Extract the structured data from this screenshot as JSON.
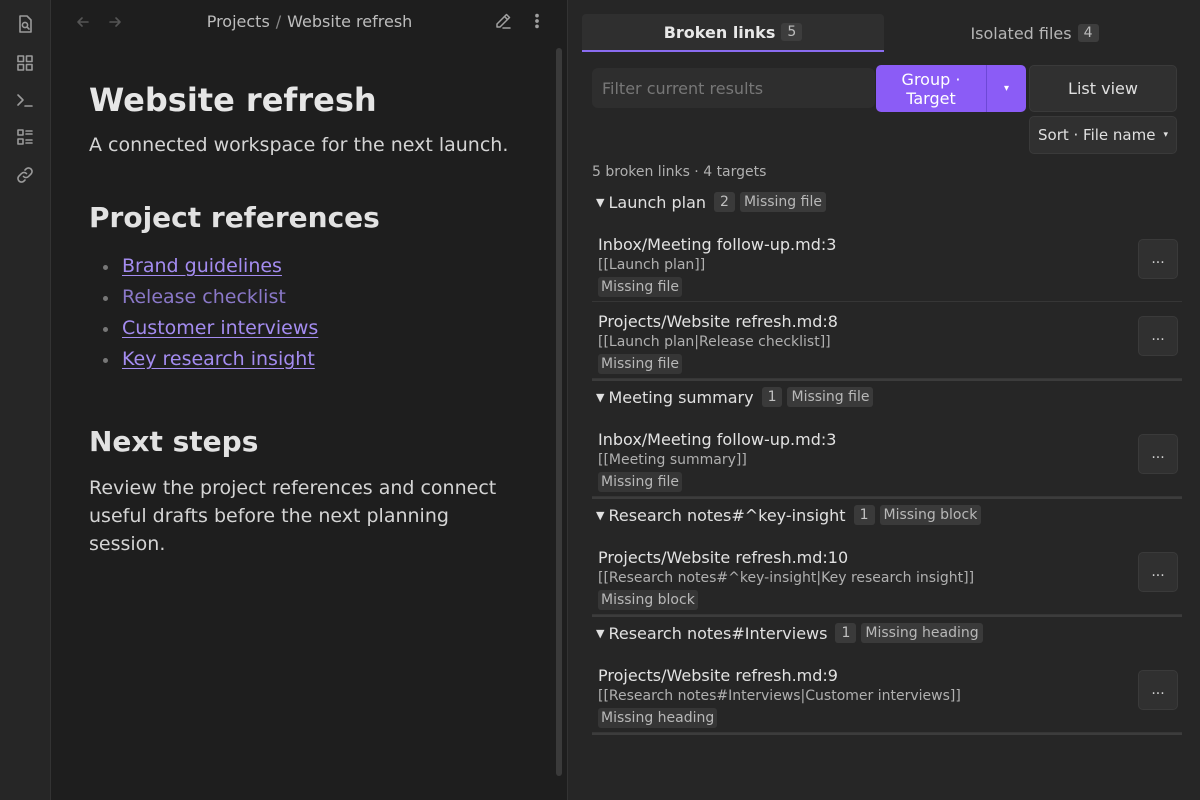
{
  "ribbon": {
    "icons": [
      "search-file-icon",
      "grid-icon",
      "terminal-icon",
      "list-icon",
      "link-icon"
    ]
  },
  "editor": {
    "breadcrumb": {
      "parent": "Projects",
      "separator": "/",
      "current": "Website refresh"
    },
    "title": "Website refresh",
    "lead": "A connected workspace for the next launch.",
    "references_heading": "Project references",
    "references": [
      {
        "label": "Brand guidelines",
        "resolved": true
      },
      {
        "label": "Release checklist",
        "resolved": false
      },
      {
        "label": "Customer interviews",
        "resolved": true
      },
      {
        "label": "Key research insight",
        "resolved": true
      }
    ],
    "next_heading": "Next steps",
    "next_text": "Review the project references and connect useful drafts before the next planning session."
  },
  "panel": {
    "tabs": [
      {
        "label": "Broken links",
        "count": "5",
        "active": true
      },
      {
        "label": "Isolated files",
        "count": "4",
        "active": false
      }
    ],
    "filter_placeholder": "Filter current results",
    "group_button": {
      "line1": "Group ·",
      "line2": "Target"
    },
    "group_dropdown": "▾",
    "list_view": "List view",
    "sort": {
      "label": "Sort · File name",
      "caret": "▾"
    },
    "summary": "5 broken links · 4 targets",
    "groups": [
      {
        "name": "Launch plan",
        "count": "2",
        "kind": "Missing file",
        "items": [
          {
            "path": "Inbox/Meeting follow-up.md:3",
            "snippet": "[[Launch plan]]",
            "kind": "Missing file",
            "action": "..."
          },
          {
            "path": "Projects/Website refresh.md:8",
            "snippet": "[[Launch plan|Release checklist]]",
            "kind": "Missing file",
            "action": "..."
          }
        ]
      },
      {
        "name": "Meeting summary",
        "count": "1",
        "kind": "Missing file",
        "items": [
          {
            "path": "Inbox/Meeting follow-up.md:3",
            "snippet": "[[Meeting summary]]",
            "kind": "Missing file",
            "action": "..."
          }
        ]
      },
      {
        "name": "Research notes#^key-insight",
        "count": "1",
        "kind": "Missing block",
        "items": [
          {
            "path": "Projects/Website refresh.md:10",
            "snippet": "[[Research notes#^key-insight|Key research insight]]",
            "kind": "Missing block",
            "action": "..."
          }
        ]
      },
      {
        "name": "Research notes#Interviews",
        "count": "1",
        "kind": "Missing heading",
        "items": [
          {
            "path": "Projects/Website refresh.md:9",
            "snippet": "[[Research notes#Interviews|Customer interviews]]",
            "kind": "Missing heading",
            "action": "..."
          }
        ]
      }
    ]
  },
  "colors": {
    "accent": "#8b5cf6",
    "link": "#a48cf0",
    "background": "#1e1e1e",
    "panel": "#262626"
  }
}
